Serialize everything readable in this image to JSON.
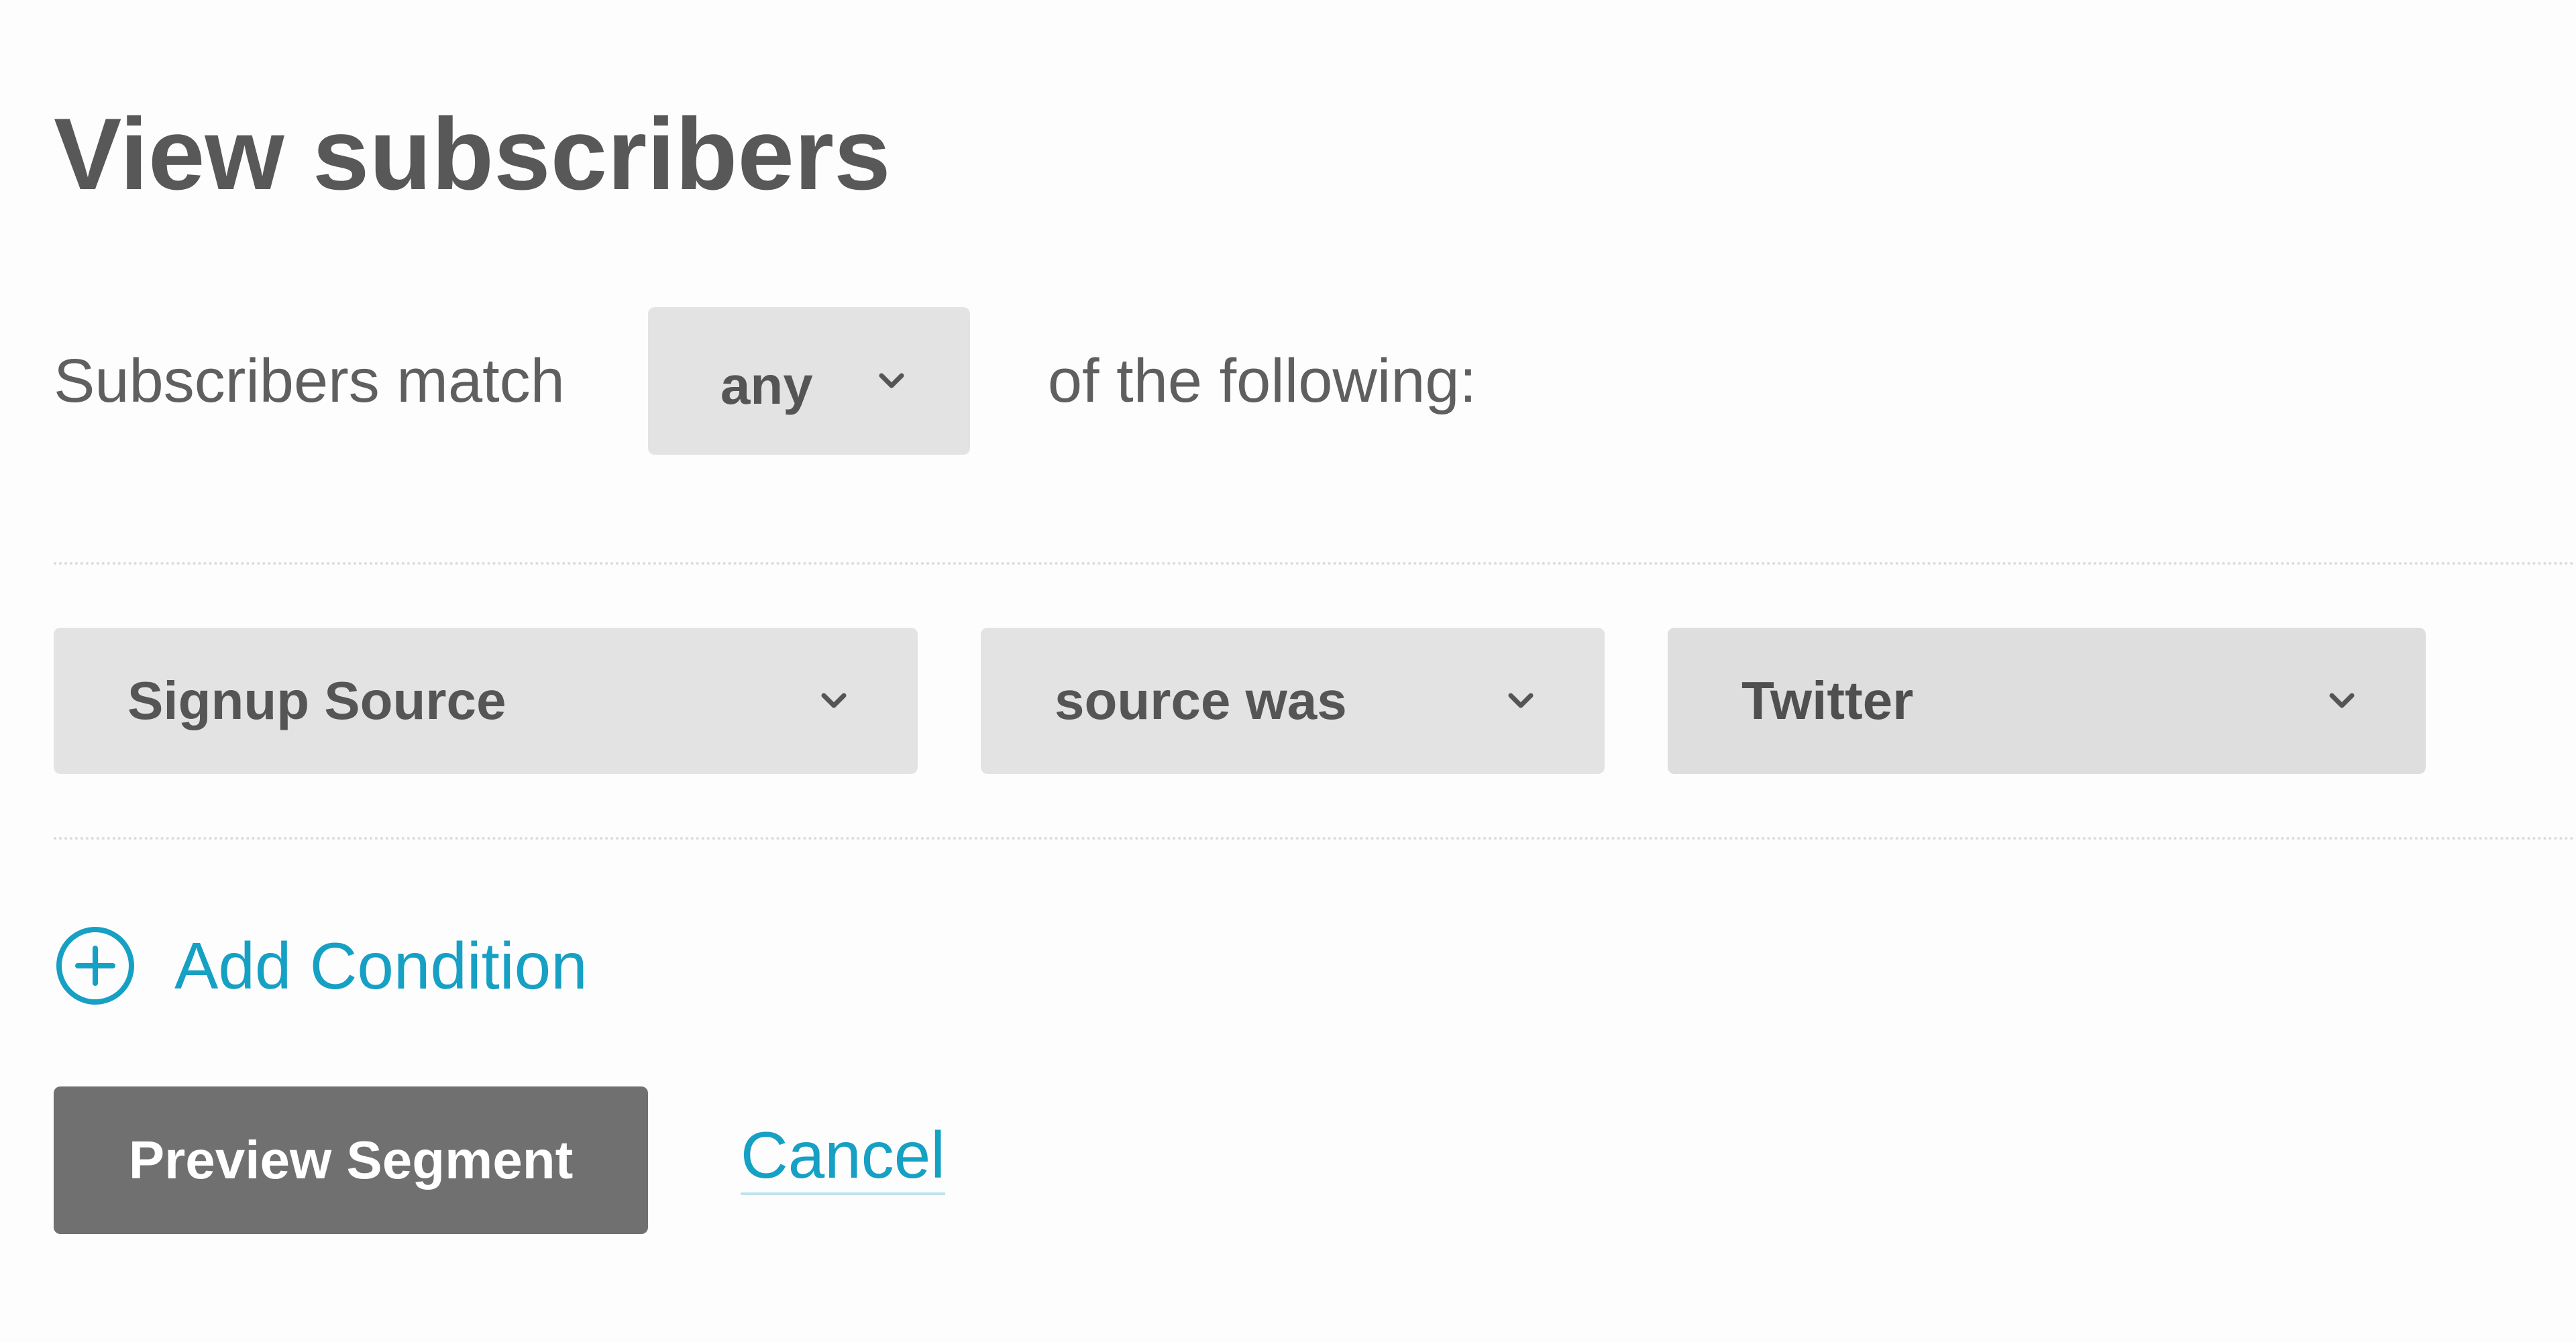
{
  "page": {
    "title": "View subscribers"
  },
  "match": {
    "prefix": "Subscribers match",
    "mode": "any",
    "suffix": "of the following:"
  },
  "condition": {
    "field": "Signup Source",
    "operator": "source was",
    "value": "Twitter"
  },
  "add_condition": {
    "label": "Add Condition",
    "icon": "plus-circle-icon"
  },
  "actions": {
    "preview_label": "Preview Segment",
    "cancel_label": "Cancel"
  },
  "colors": {
    "accent": "#16a0c4",
    "select_bg": "#e3e3e3",
    "primary_button_bg": "#707070",
    "text": "#585858"
  }
}
